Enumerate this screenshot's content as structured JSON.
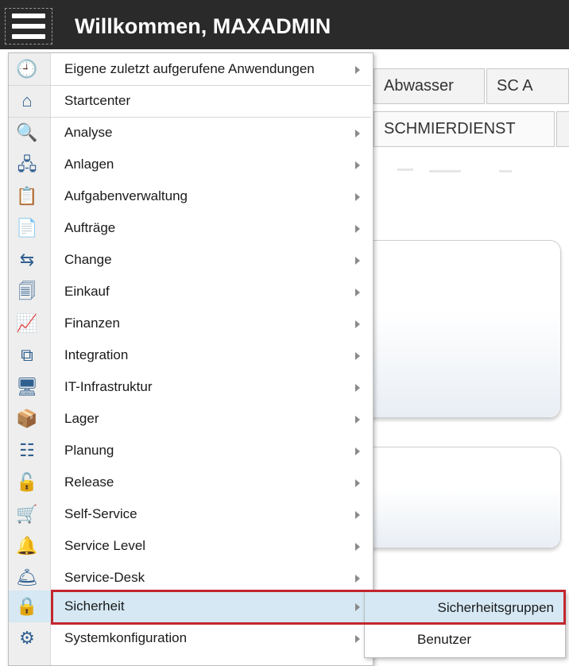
{
  "header": {
    "title": "Willkommen, MAXADMIN",
    "menu_icon": "hamburger-icon"
  },
  "tabs_row1": [
    "Abwasser",
    "SC A"
  ],
  "tabs_row2": [
    "SCHMIERDIENST"
  ],
  "menu": {
    "items": [
      {
        "label": "Eigene zuletzt aufgerufene Anwendungen",
        "icon": "recent-apps-icon",
        "submenu": true,
        "glyph": "🕘"
      },
      {
        "label": "Startcenter",
        "icon": "home-icon",
        "submenu": false,
        "glyph": "⌂"
      },
      {
        "label": "Analyse",
        "icon": "analysis-icon",
        "submenu": true,
        "glyph": "🔍"
      },
      {
        "label": "Anlagen",
        "icon": "assets-icon",
        "submenu": true,
        "glyph": "🖧"
      },
      {
        "label": "Aufgabenverwaltung",
        "icon": "task-management-icon",
        "submenu": true,
        "glyph": "📋"
      },
      {
        "label": "Aufträge",
        "icon": "work-orders-icon",
        "submenu": true,
        "glyph": "📄"
      },
      {
        "label": "Change",
        "icon": "change-icon",
        "submenu": true,
        "glyph": "⇆"
      },
      {
        "label": "Einkauf",
        "icon": "purchasing-icon",
        "submenu": true,
        "glyph": "🗐"
      },
      {
        "label": "Finanzen",
        "icon": "finance-icon",
        "submenu": true,
        "glyph": "📈"
      },
      {
        "label": "Integration",
        "icon": "integration-icon",
        "submenu": true,
        "glyph": "⧉"
      },
      {
        "label": "IT-Infrastruktur",
        "icon": "it-infrastructure-icon",
        "submenu": true,
        "glyph": "🖥"
      },
      {
        "label": "Lager",
        "icon": "inventory-icon",
        "submenu": true,
        "glyph": "📦"
      },
      {
        "label": "Planung",
        "icon": "planning-icon",
        "submenu": true,
        "glyph": "☷"
      },
      {
        "label": "Release",
        "icon": "release-icon",
        "submenu": true,
        "glyph": "🔓"
      },
      {
        "label": "Self-Service",
        "icon": "self-service-icon",
        "submenu": true,
        "glyph": "🛒"
      },
      {
        "label": "Service Level",
        "icon": "service-level-icon",
        "submenu": true,
        "glyph": "🔔"
      },
      {
        "label": "Service-Desk",
        "icon": "service-desk-icon",
        "submenu": true,
        "glyph": "🛎"
      },
      {
        "label": "Sicherheit",
        "icon": "security-lock-icon",
        "submenu": true,
        "glyph": "🔒"
      },
      {
        "label": "Systemkonfiguration",
        "icon": "system-configuration-icon",
        "submenu": true,
        "glyph": "⚙"
      }
    ]
  },
  "submenu": {
    "items": [
      {
        "label": "Sicherheitsgruppen"
      },
      {
        "label": "Benutzer"
      }
    ]
  },
  "colors": {
    "header_bg": "#2a2a2a",
    "highlight_bg": "#d5e8f3",
    "annotation_red": "#c3262e"
  }
}
